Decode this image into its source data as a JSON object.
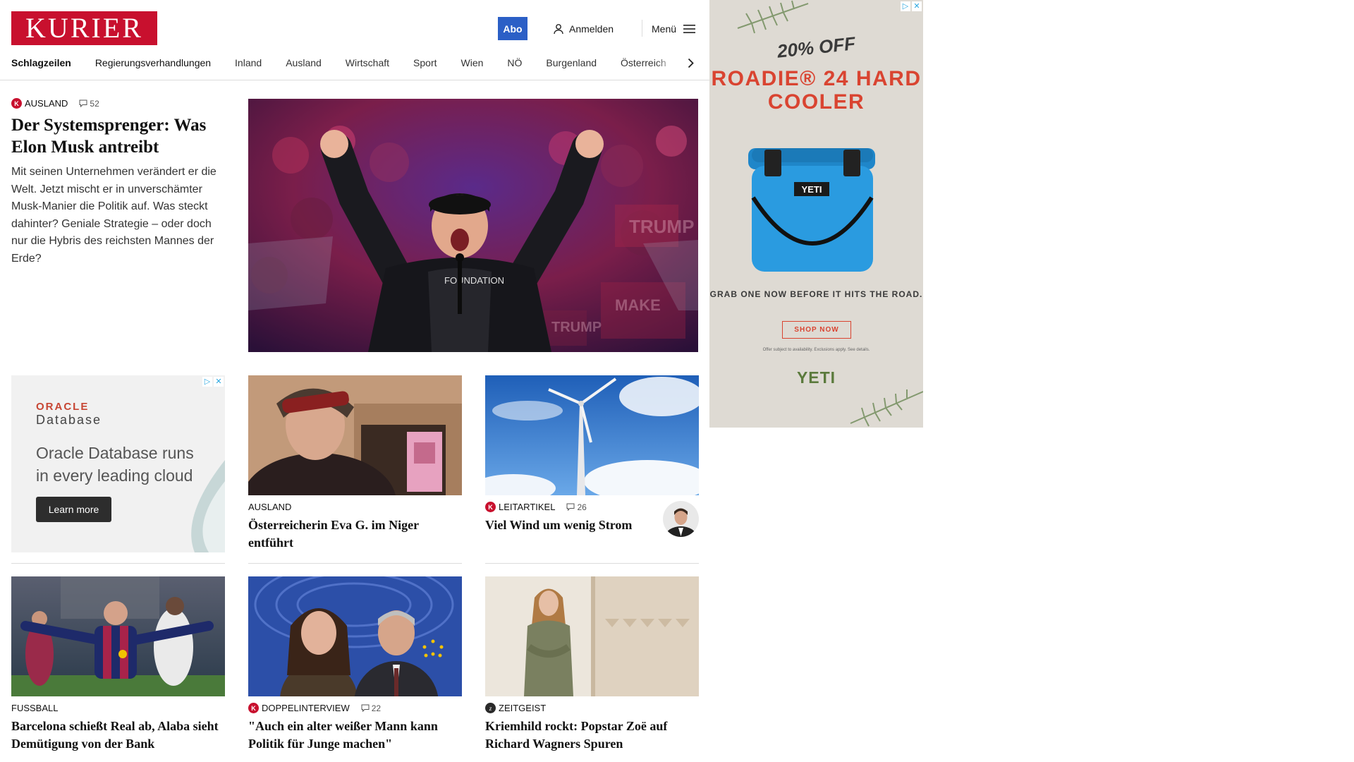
{
  "header": {
    "logo": "KURIER",
    "abo_label": "Abo",
    "login_label": "Anmelden",
    "menu_label": "Menü",
    "nav": [
      "Schlagzeilen",
      "Regierungsverhandlungen",
      "Inland",
      "Ausland",
      "Wirtschaft",
      "Sport",
      "Wien",
      "NÖ",
      "Burgenland",
      "Österreich"
    ]
  },
  "lead": {
    "category": "AUSLAND",
    "comments": "52",
    "title": "Der Systemsprenger: Was Elon Musk antreibt",
    "teaser": "Mit seinen Unternehmen verändert er die Welt. Jetzt mischt er in unverschämter Musk-Manier die Politik auf. Was steckt dahinter? Geniale Strategie – oder doch nur die Hybris des reichsten Mannes der Erde?",
    "image_alt": "Elon Musk jubelt auf einer Bühne",
    "shirt_text": "FOUNDATION"
  },
  "ads": {
    "oracle": {
      "brand": "ORACLE",
      "product": "Database",
      "headline": "Oracle Database runs in every leading cloud",
      "button": "Learn more",
      "choices_icon": "ad-choices-icon",
      "close_icon": "close-icon"
    },
    "yeti": {
      "offer": "20% OFF",
      "title": "ROADIE® 24 HARD COOLER",
      "cooler_label": "YETI",
      "cta": "GRAB ONE NOW BEFORE IT HITS THE ROAD.",
      "button": "SHOP NOW",
      "fine_print": "Offer subject to availability. Exclusions apply. See details.",
      "logo": "YETI"
    }
  },
  "cards": [
    {
      "category": "AUSLAND",
      "title": "Österreicherin Eva G. im Niger entführt",
      "premium": false,
      "comments": ""
    },
    {
      "category": "LEITARTIKEL",
      "title": "Viel Wind um wenig Strom",
      "premium": true,
      "comments": "26"
    },
    {
      "category": "FUSSBALL",
      "title": "Barcelona schießt Real ab, Alaba sieht Demütigung von der Bank",
      "premium": false,
      "comments": ""
    },
    {
      "category": "DOPPELINTERVIEW",
      "title": "\"Auch ein alter weißer Mann kann Politik für Junge machen\"",
      "premium": true,
      "comments": "22"
    },
    {
      "category": "ZEITGEIST",
      "title": "Kriemhild rockt: Popstar Zoë auf Richard Wagners Spuren",
      "premium": false,
      "comments": ""
    }
  ],
  "colors": {
    "brand_red": "#c8102e",
    "abo_blue": "#2b5fc6",
    "yeti_red": "#d94431",
    "yeti_green": "#5b7a3c"
  }
}
